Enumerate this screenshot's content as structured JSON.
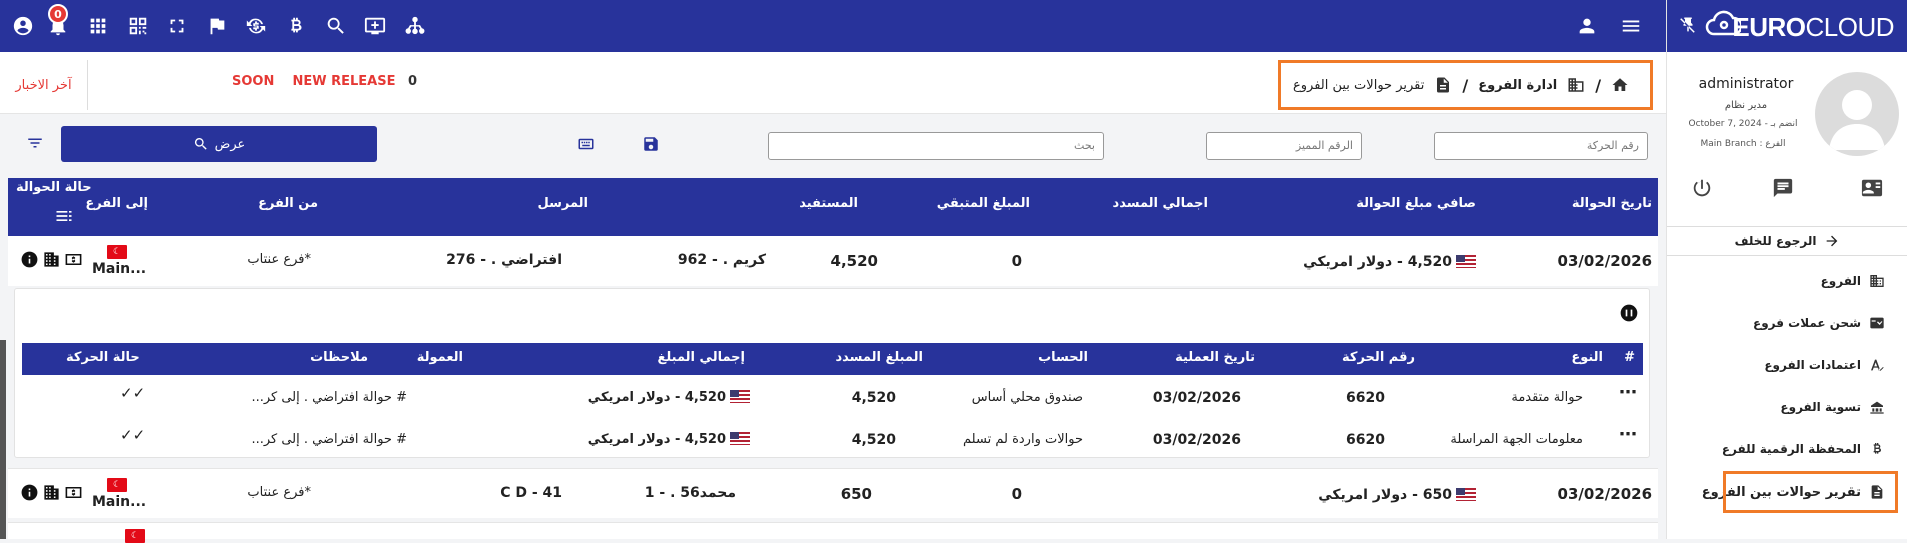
{
  "topbar": {
    "notification_count": "0",
    "icons": [
      "account-circle-icon",
      "bell-icon",
      "apps-grid-icon",
      "qr-code-icon",
      "fullscreen-icon",
      "flag-icon",
      "currency-exchange-icon",
      "bitcoin-icon",
      "search-icon",
      "monitor-add-icon",
      "hierarchy-icon",
      "person-icon",
      "menu-icon"
    ]
  },
  "brand": {
    "logo_part1": "EURO",
    "logo_part2": "CLOUD"
  },
  "news": {
    "label": "آخر الاخبار",
    "soon": "SOON",
    "release": "NEW RELEASE",
    "count": "0"
  },
  "breadcrumb": {
    "branches": "ادارة الفروع",
    "current": "تقرير حوالات بين الفروع"
  },
  "filters": {
    "movement_no_placeholder": "رقم الحركة",
    "special_no_placeholder": "الرقم المميز",
    "search_placeholder": "بحث",
    "show_label": "عرض"
  },
  "table": {
    "headers": {
      "date": "تاريخ الحوالة",
      "net": "صافي مبلغ الحوالة",
      "paid_total": "اجمالي المسدد",
      "remaining": "المبلغ المتبقي",
      "beneficiary": "المستفيد",
      "sender": "المرسل",
      "from_branch": "من الفرع",
      "to_branch": "إلى الفرع",
      "status": "حالة الحوالة"
    },
    "rows": [
      {
        "date": "03/02/2026",
        "net": "4,520 - دولار امريكي",
        "paid": "0",
        "remaining": "4,520",
        "beneficiary": "كريم . - 962",
        "sender": "افتراضي . - 276",
        "from": "*فرع عنتاب",
        "to": "Main..."
      },
      {
        "date": "03/02/2026",
        "net": "650 - دولار امريكي",
        "paid": "0",
        "remaining": "650",
        "beneficiary": "محمد56 . - 1",
        "sender": "C D - 41",
        "from": "*فرع عنتاب",
        "to": "Main..."
      }
    ]
  },
  "detail": {
    "headers": {
      "hash": "#",
      "type": "النوع",
      "movement_no": "رقم الحركة",
      "op_date": "تاريخ العملية",
      "account": "الحساب",
      "paid": "المبلغ المسدد",
      "total": "إجمالي المبلغ",
      "commission": "العمولة",
      "notes": "ملاحظات",
      "status": "حالة الحركة"
    },
    "rows": [
      {
        "type": "حوالة متقدمة",
        "movement_no": "6620",
        "op_date": "03/02/2026",
        "account": "صندوق محلي أساس",
        "paid": "4,520",
        "total": "4,520 - دولار امريكي",
        "notes": "# حوالة افتراضي . إلى كر..."
      },
      {
        "type": "معلومات الجهة المراسلة",
        "movement_no": "6620",
        "op_date": "03/02/2026",
        "account": "حوالات واردة لم تسلم",
        "paid": "4,520",
        "total": "4,520 - دولار امريكي",
        "notes": "# حوالة افتراضي . إلى كر..."
      }
    ]
  },
  "user": {
    "name": "administrator",
    "role": "مدير نظام",
    "joined": "October 7, 2024 - انضم بـ",
    "branch": "Main Branch : الفرع"
  },
  "sidebar": {
    "back": "الرجوع للخلف",
    "items": [
      "الفروع",
      "شحن عملات فروع",
      "اعتمادات الفروع",
      "تسوية الفروع",
      "المحفظة الرقمية للفرع",
      "تقرير حوالات بين الفروع"
    ]
  }
}
